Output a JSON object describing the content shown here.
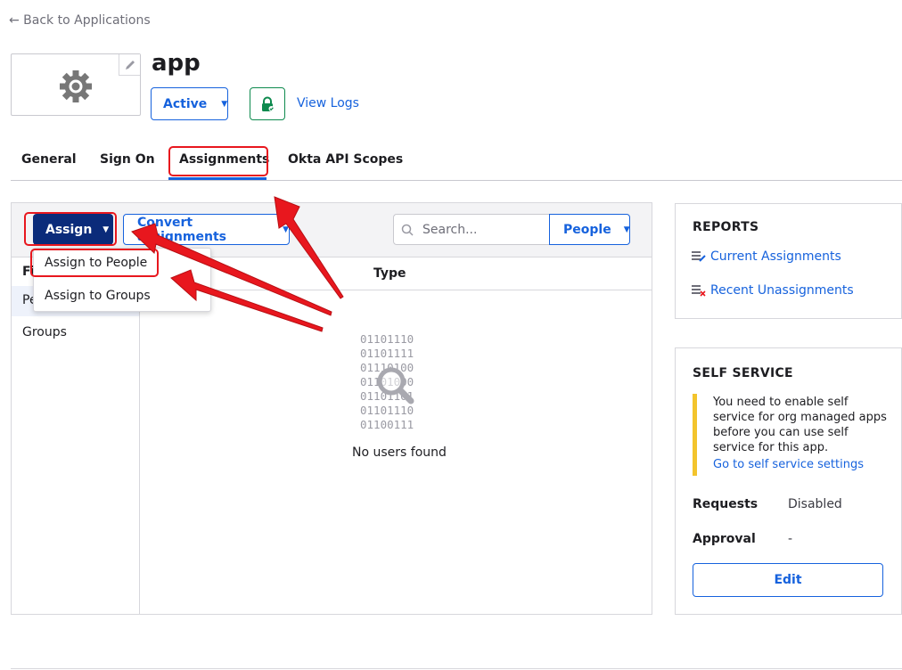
{
  "nav": {
    "back_link": "← Back to Applications"
  },
  "app": {
    "name": "app",
    "status_label": "Active",
    "view_logs_label": "View Logs",
    "logo_icon": "gear-icon",
    "edit_icon": "pencil-icon",
    "lock_icon": "lock-icon"
  },
  "tabs": [
    {
      "label": "General"
    },
    {
      "label": "Sign On"
    },
    {
      "label": "Assignments",
      "active": true
    },
    {
      "label": "Okta API Scopes"
    }
  ],
  "assignments": {
    "assign_label": "Assign",
    "convert_label": "Convert assignments",
    "search_placeholder": "Search...",
    "people_filter_label": "People",
    "menu": [
      "Assign to People",
      "Assign to Groups"
    ],
    "filters": {
      "heading": "Fi",
      "people": "Pe",
      "groups": "Groups"
    },
    "column_type": "Type",
    "empty_binary": "01101110\n01101111\n01110100\n01101000\n01101101\n01101110\n01100111",
    "empty_text": "No users found"
  },
  "reports": {
    "title": "REPORTS",
    "current": "Current Assignments",
    "recent": "Recent Unassignments"
  },
  "self_service": {
    "title": "SELF SERVICE",
    "notice": "You need to enable self service for org managed apps before you can use self service for this app.",
    "settings_link": "Go to self service settings",
    "requests_label": "Requests",
    "requests_value": "Disabled",
    "approval_label": "Approval",
    "approval_value": "-",
    "edit_label": "Edit"
  },
  "colors": {
    "accent": "#1662dd",
    "assign_button": "#0b2b7a",
    "annotation": "#e8171e",
    "notice": "#f3c42c",
    "success": "#0e8a4e"
  }
}
